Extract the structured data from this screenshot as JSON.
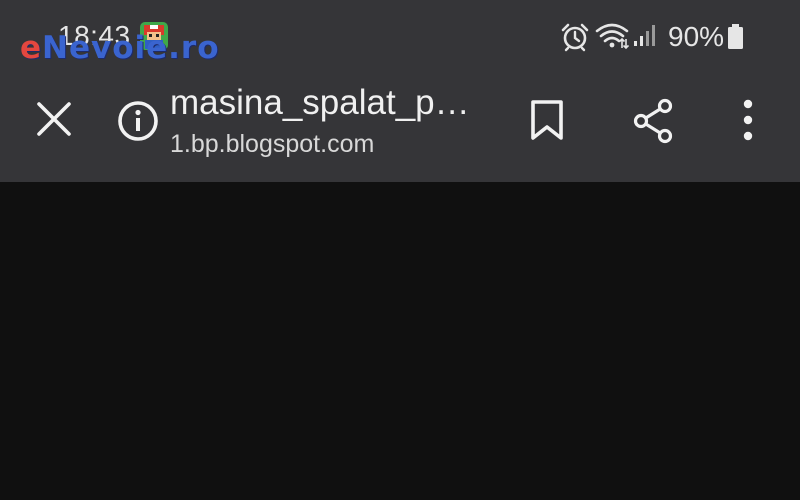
{
  "status_bar": {
    "time": "18:43",
    "battery_percent": "90%",
    "app_icon": "game-app-icon",
    "icons": [
      "alarm-icon",
      "wifi-icon",
      "signal-icon",
      "battery-icon"
    ]
  },
  "watermark": {
    "first_letter": "e",
    "rest": "Nevoie.ro"
  },
  "toolbar": {
    "close_icon": "close-icon",
    "info_icon": "info-icon",
    "title": "masina_spalat_p…",
    "url": "1.bp.blogspot.com",
    "bookmark_icon": "bookmark-icon",
    "share_icon": "share-icon",
    "menu_icon": "more-vert-icon"
  },
  "colors": {
    "toolbar_bg": "#353538",
    "content_bg": "#101010",
    "text_primary": "#f0f0f0",
    "watermark_red": "#e4473f",
    "watermark_blue": "#3a64cf"
  }
}
